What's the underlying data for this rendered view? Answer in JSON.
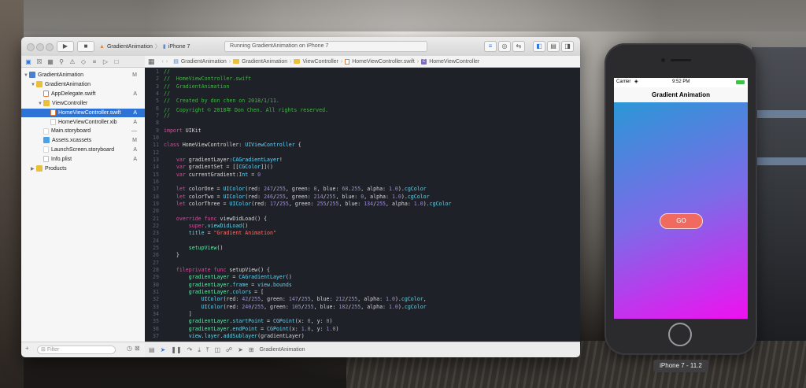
{
  "xcode": {
    "toolbar": {
      "scheme_target": "GradientAnimation",
      "scheme_sep": "〉",
      "scheme_device": "iPhone 7",
      "activity_status": "Running GradientAnimation on iPhone 7"
    },
    "jumpbar": [
      "GradientAnimation",
      "GradientAnimation",
      "ViewController",
      "HomeViewController.swift",
      "HomeViewController"
    ],
    "navigator": {
      "items": [
        {
          "label": "GradientAnimation",
          "status": "M",
          "depth": 0,
          "icon": "project-icon",
          "expanded": true
        },
        {
          "label": "GradientAnimation",
          "status": "",
          "depth": 1,
          "icon": "folder-icon",
          "expanded": true
        },
        {
          "label": "AppDelegate.swift",
          "status": "A",
          "depth": 2,
          "icon": "swift-file-icon"
        },
        {
          "label": "ViewController",
          "status": "",
          "depth": 2,
          "icon": "folder-icon",
          "expanded": true
        },
        {
          "label": "HomeViewController.swift",
          "status": "A",
          "depth": 3,
          "icon": "swift-file-icon",
          "selected": true
        },
        {
          "label": "HomeViewController.xib",
          "status": "A",
          "depth": 3,
          "icon": "xib-file-icon"
        },
        {
          "label": "Main.storyboard",
          "status": "—",
          "depth": 2,
          "icon": "storyboard-icon"
        },
        {
          "label": "Assets.xcassets",
          "status": "M",
          "depth": 2,
          "icon": "assets-icon"
        },
        {
          "label": "LaunchScreen.storyboard",
          "status": "A",
          "depth": 2,
          "icon": "storyboard-icon"
        },
        {
          "label": "Info.plist",
          "status": "A",
          "depth": 2,
          "icon": "plist-icon"
        },
        {
          "label": "Products",
          "status": "",
          "depth": 1,
          "icon": "folder-icon",
          "expanded": false
        }
      ],
      "filter_placeholder": "Filter"
    },
    "debug_bar": {
      "target": "GradientAnimation"
    },
    "code_lines": [
      [
        [
          "c",
          "//"
        ]
      ],
      [
        [
          "c",
          "//  HomeViewController.swift"
        ]
      ],
      [
        [
          "c",
          "//  GradientAnimation"
        ]
      ],
      [
        [
          "c",
          "//"
        ]
      ],
      [
        [
          "c",
          "//  Created by don chen on 2018/1/11."
        ]
      ],
      [
        [
          "c",
          "//  Copyright © 2018年 Don Chen. All rights reserved."
        ]
      ],
      [
        [
          "c",
          "//"
        ]
      ],
      [],
      [
        [
          "k",
          "import"
        ],
        [
          "p",
          " UIKit"
        ]
      ],
      [],
      [
        [
          "k",
          "class"
        ],
        [
          "p",
          " HomeViewController: "
        ],
        [
          "t",
          "UIViewController"
        ],
        [
          "p",
          " {"
        ]
      ],
      [],
      [
        [
          "p",
          "    "
        ],
        [
          "k",
          "var"
        ],
        [
          "p",
          " gradientLayer:"
        ],
        [
          "t",
          "CAGradientLayer"
        ],
        [
          "p",
          "!"
        ]
      ],
      [
        [
          "p",
          "    "
        ],
        [
          "k",
          "var"
        ],
        [
          "p",
          " gradientSet = [["
        ],
        [
          "t",
          "CGColor"
        ],
        [
          "p",
          "]]()"
        ]
      ],
      [
        [
          "p",
          "    "
        ],
        [
          "k",
          "var"
        ],
        [
          "p",
          " currentGradient:"
        ],
        [
          "t",
          "Int"
        ],
        [
          "p",
          " = "
        ],
        [
          "n",
          "0"
        ]
      ],
      [],
      [
        [
          "p",
          "    "
        ],
        [
          "k",
          "let"
        ],
        [
          "p",
          " colorOne = "
        ],
        [
          "t",
          "UIColor"
        ],
        [
          "p",
          "(red: "
        ],
        [
          "n",
          "247"
        ],
        [
          "p",
          "/"
        ],
        [
          "n",
          "255"
        ],
        [
          "p",
          ", green: "
        ],
        [
          "n",
          "0"
        ],
        [
          "p",
          ", blue: "
        ],
        [
          "n",
          "68"
        ],
        [
          "p",
          "."
        ],
        [
          "n",
          "255"
        ],
        [
          "p",
          ", alpha: "
        ],
        [
          "n",
          "1.0"
        ],
        [
          "p",
          ")."
        ],
        [
          "m",
          "cgColor"
        ]
      ],
      [
        [
          "p",
          "    "
        ],
        [
          "k",
          "let"
        ],
        [
          "p",
          " colorTwo = "
        ],
        [
          "t",
          "UIColor"
        ],
        [
          "p",
          "(red: "
        ],
        [
          "n",
          "246"
        ],
        [
          "p",
          "/"
        ],
        [
          "n",
          "255"
        ],
        [
          "p",
          ", green: "
        ],
        [
          "n",
          "214"
        ],
        [
          "p",
          "/"
        ],
        [
          "n",
          "255"
        ],
        [
          "p",
          ", blue: "
        ],
        [
          "n",
          "0"
        ],
        [
          "p",
          ", alpha: "
        ],
        [
          "n",
          "1.0"
        ],
        [
          "p",
          ")."
        ],
        [
          "m",
          "cgColor"
        ]
      ],
      [
        [
          "p",
          "    "
        ],
        [
          "k",
          "let"
        ],
        [
          "p",
          " colorThree = "
        ],
        [
          "t",
          "UIColor"
        ],
        [
          "p",
          "(red: "
        ],
        [
          "n",
          "17"
        ],
        [
          "p",
          "/"
        ],
        [
          "n",
          "255"
        ],
        [
          "p",
          ", green: "
        ],
        [
          "n",
          "255"
        ],
        [
          "p",
          "/"
        ],
        [
          "n",
          "255"
        ],
        [
          "p",
          ", blue: "
        ],
        [
          "n",
          "134"
        ],
        [
          "p",
          "/"
        ],
        [
          "n",
          "255"
        ],
        [
          "p",
          ", alpha: "
        ],
        [
          "n",
          "1.0"
        ],
        [
          "p",
          ")."
        ],
        [
          "m",
          "cgColor"
        ]
      ],
      [],
      [
        [
          "p",
          "    "
        ],
        [
          "k",
          "override"
        ],
        [
          "p",
          " "
        ],
        [
          "k",
          "func"
        ],
        [
          "p",
          " viewDidLoad() {"
        ]
      ],
      [
        [
          "p",
          "        "
        ],
        [
          "k",
          "super"
        ],
        [
          "p",
          "."
        ],
        [
          "m",
          "viewDidLoad"
        ],
        [
          "p",
          "()"
        ]
      ],
      [
        [
          "p",
          "        "
        ],
        [
          "m",
          "title"
        ],
        [
          "p",
          " = "
        ],
        [
          "s",
          "\"Gradient Animation\""
        ]
      ],
      [],
      [
        [
          "p",
          "        "
        ],
        [
          "i",
          "setupView"
        ],
        [
          "p",
          "()"
        ]
      ],
      [
        [
          "p",
          "    }"
        ]
      ],
      [],
      [
        [
          "p",
          "    "
        ],
        [
          "k",
          "fileprivate"
        ],
        [
          "p",
          " "
        ],
        [
          "k",
          "func"
        ],
        [
          "p",
          " setupView() {"
        ]
      ],
      [
        [
          "p",
          "        "
        ],
        [
          "i",
          "gradientLayer"
        ],
        [
          "p",
          " = "
        ],
        [
          "t",
          "CAGradientLayer"
        ],
        [
          "p",
          "()"
        ]
      ],
      [
        [
          "p",
          "        "
        ],
        [
          "i",
          "gradientLayer"
        ],
        [
          "p",
          "."
        ],
        [
          "m",
          "frame"
        ],
        [
          "p",
          " = "
        ],
        [
          "m",
          "view"
        ],
        [
          "p",
          "."
        ],
        [
          "m",
          "bounds"
        ]
      ],
      [
        [
          "p",
          "        "
        ],
        [
          "i",
          "gradientLayer"
        ],
        [
          "p",
          "."
        ],
        [
          "m",
          "colors"
        ],
        [
          "p",
          " = ["
        ]
      ],
      [
        [
          "p",
          "            "
        ],
        [
          "t",
          "UIColor"
        ],
        [
          "p",
          "(red: "
        ],
        [
          "n",
          "42"
        ],
        [
          "p",
          "/"
        ],
        [
          "n",
          "255"
        ],
        [
          "p",
          ", green: "
        ],
        [
          "n",
          "147"
        ],
        [
          "p",
          "/"
        ],
        [
          "n",
          "255"
        ],
        [
          "p",
          ", blue: "
        ],
        [
          "n",
          "212"
        ],
        [
          "p",
          "/"
        ],
        [
          "n",
          "255"
        ],
        [
          "p",
          ", alpha: "
        ],
        [
          "n",
          "1.0"
        ],
        [
          "p",
          ")."
        ],
        [
          "m",
          "cgColor"
        ],
        [
          "p",
          ","
        ]
      ],
      [
        [
          "p",
          "            "
        ],
        [
          "t",
          "UIColor"
        ],
        [
          "p",
          "(red: "
        ],
        [
          "n",
          "240"
        ],
        [
          "p",
          "/"
        ],
        [
          "n",
          "255"
        ],
        [
          "p",
          ", green: "
        ],
        [
          "n",
          "105"
        ],
        [
          "p",
          "/"
        ],
        [
          "n",
          "255"
        ],
        [
          "p",
          ", blue: "
        ],
        [
          "n",
          "182"
        ],
        [
          "p",
          "/"
        ],
        [
          "n",
          "255"
        ],
        [
          "p",
          ", alpha: "
        ],
        [
          "n",
          "1.0"
        ],
        [
          "p",
          ")."
        ],
        [
          "m",
          "cgColor"
        ]
      ],
      [
        [
          "p",
          "        ]"
        ]
      ],
      [
        [
          "p",
          "        "
        ],
        [
          "i",
          "gradientLayer"
        ],
        [
          "p",
          "."
        ],
        [
          "m",
          "startPoint"
        ],
        [
          "p",
          " = "
        ],
        [
          "t",
          "CGPoint"
        ],
        [
          "p",
          "(x: "
        ],
        [
          "n",
          "0"
        ],
        [
          "p",
          ", y: "
        ],
        [
          "n",
          "0"
        ],
        [
          "p",
          ")"
        ]
      ],
      [
        [
          "p",
          "        "
        ],
        [
          "i",
          "gradientLayer"
        ],
        [
          "p",
          "."
        ],
        [
          "m",
          "endPoint"
        ],
        [
          "p",
          " = "
        ],
        [
          "t",
          "CGPoint"
        ],
        [
          "p",
          "(x: "
        ],
        [
          "n",
          "1.0"
        ],
        [
          "p",
          ", y: "
        ],
        [
          "n",
          "1.0"
        ],
        [
          "p",
          ")"
        ]
      ],
      [
        [
          "p",
          "        "
        ],
        [
          "m",
          "view"
        ],
        [
          "p",
          "."
        ],
        [
          "m",
          "layer"
        ],
        [
          "p",
          "."
        ],
        [
          "m",
          "addSublayer"
        ],
        [
          "p",
          "(gradientLayer)"
        ]
      ]
    ]
  },
  "simulator": {
    "carrier": "Carrier",
    "time": "9:52 PM",
    "nav_title": "Gradient Animation",
    "go_button": "GO",
    "device_label": "iPhone 7 - 11.2",
    "gradient_colors": [
      "#2b97d6",
      "#7d6ae8",
      "#f010f0"
    ]
  },
  "colors": {
    "accent": "#2d73d6",
    "go_button": "#f06a5f"
  }
}
